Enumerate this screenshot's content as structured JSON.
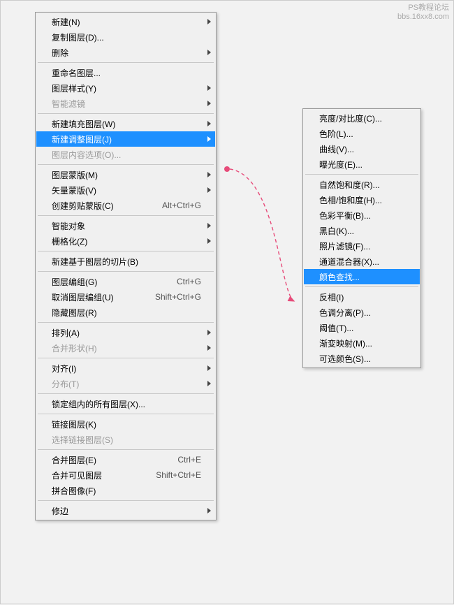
{
  "watermark": {
    "line1": "PS教程论坛",
    "line2": "bbs.16xx8.com"
  },
  "leftMenu": [
    {
      "type": "item",
      "label": "新建(N)",
      "arrow": true
    },
    {
      "type": "item",
      "label": "复制图层(D)..."
    },
    {
      "type": "item",
      "label": "删除",
      "arrow": true
    },
    {
      "type": "sep"
    },
    {
      "type": "item",
      "label": "重命名图层..."
    },
    {
      "type": "item",
      "label": "图层样式(Y)",
      "arrow": true
    },
    {
      "type": "item",
      "label": "智能滤镜",
      "arrow": true,
      "disabled": true
    },
    {
      "type": "sep"
    },
    {
      "type": "item",
      "label": "新建填充图层(W)",
      "arrow": true
    },
    {
      "type": "item",
      "label": "新建调整图层(J)",
      "arrow": true,
      "highlighted": true
    },
    {
      "type": "item",
      "label": "图层内容选项(O)...",
      "disabled": true
    },
    {
      "type": "sep"
    },
    {
      "type": "item",
      "label": "图层蒙版(M)",
      "arrow": true
    },
    {
      "type": "item",
      "label": "矢量蒙版(V)",
      "arrow": true
    },
    {
      "type": "item",
      "label": "创建剪贴蒙版(C)",
      "shortcut": "Alt+Ctrl+G"
    },
    {
      "type": "sep"
    },
    {
      "type": "item",
      "label": "智能对象",
      "arrow": true
    },
    {
      "type": "item",
      "label": "栅格化(Z)",
      "arrow": true
    },
    {
      "type": "sep"
    },
    {
      "type": "item",
      "label": "新建基于图层的切片(B)"
    },
    {
      "type": "sep"
    },
    {
      "type": "item",
      "label": "图层编组(G)",
      "shortcut": "Ctrl+G"
    },
    {
      "type": "item",
      "label": "取消图层编组(U)",
      "shortcut": "Shift+Ctrl+G"
    },
    {
      "type": "item",
      "label": "隐藏图层(R)"
    },
    {
      "type": "sep"
    },
    {
      "type": "item",
      "label": "排列(A)",
      "arrow": true
    },
    {
      "type": "item",
      "label": "合并形状(H)",
      "arrow": true,
      "disabled": true
    },
    {
      "type": "sep"
    },
    {
      "type": "item",
      "label": "对齐(I)",
      "arrow": true
    },
    {
      "type": "item",
      "label": "分布(T)",
      "arrow": true,
      "disabled": true
    },
    {
      "type": "sep"
    },
    {
      "type": "item",
      "label": "锁定组内的所有图层(X)..."
    },
    {
      "type": "sep"
    },
    {
      "type": "item",
      "label": "链接图层(K)"
    },
    {
      "type": "item",
      "label": "选择链接图层(S)",
      "disabled": true
    },
    {
      "type": "sep"
    },
    {
      "type": "item",
      "label": "合并图层(E)",
      "shortcut": "Ctrl+E"
    },
    {
      "type": "item",
      "label": "合并可见图层",
      "shortcut": "Shift+Ctrl+E"
    },
    {
      "type": "item",
      "label": "拼合图像(F)"
    },
    {
      "type": "sep"
    },
    {
      "type": "item",
      "label": "修边",
      "arrow": true
    }
  ],
  "rightMenu": [
    {
      "type": "item",
      "label": "亮度/对比度(C)..."
    },
    {
      "type": "item",
      "label": "色阶(L)..."
    },
    {
      "type": "item",
      "label": "曲线(V)..."
    },
    {
      "type": "item",
      "label": "曝光度(E)..."
    },
    {
      "type": "sep"
    },
    {
      "type": "item",
      "label": "自然饱和度(R)..."
    },
    {
      "type": "item",
      "label": "色相/饱和度(H)..."
    },
    {
      "type": "item",
      "label": "色彩平衡(B)..."
    },
    {
      "type": "item",
      "label": "黑白(K)..."
    },
    {
      "type": "item",
      "label": "照片滤镜(F)..."
    },
    {
      "type": "item",
      "label": "通道混合器(X)..."
    },
    {
      "type": "item",
      "label": "颜色查找...",
      "highlighted": true
    },
    {
      "type": "sep"
    },
    {
      "type": "item",
      "label": "反相(I)"
    },
    {
      "type": "item",
      "label": "色调分离(P)..."
    },
    {
      "type": "item",
      "label": "阈值(T)..."
    },
    {
      "type": "item",
      "label": "渐变映射(M)..."
    },
    {
      "type": "item",
      "label": "可选颜色(S)..."
    }
  ]
}
